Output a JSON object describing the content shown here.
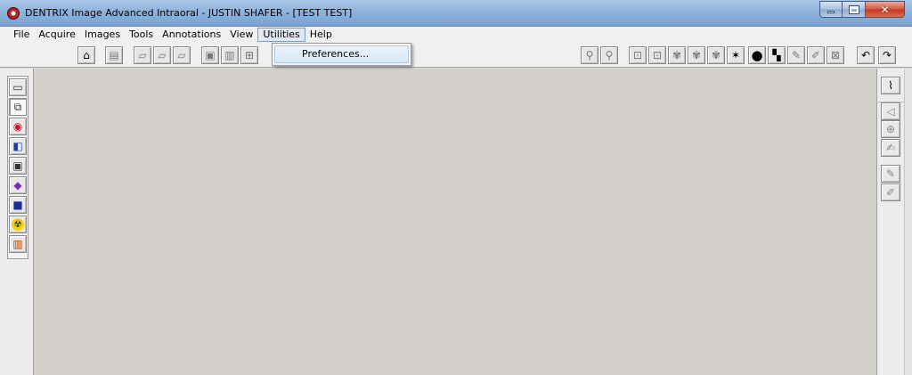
{
  "window": {
    "title": "DENTRIX Image Advanced Intraoral - JUSTIN SHAFER - [TEST TEST]",
    "buttons": {
      "minimize": "minimize-icon",
      "maximize": "maximize-icon",
      "close": "close-icon"
    },
    "close_glyph": "✕"
  },
  "menubar": {
    "items": [
      "File",
      "Acquire",
      "Images",
      "Tools",
      "Annotations",
      "View",
      "Utilities",
      "Help"
    ],
    "open_menu": "Utilities"
  },
  "utilities_menu": {
    "items": [
      "Preferences..."
    ]
  },
  "toolbar": {
    "buttons": [
      "tooth-capture-icon",
      "sensor-icon",
      "copy-icon",
      "paste-icon",
      "clipboard-icon",
      "save-icon",
      "print-icon",
      "layout-icon",
      "zoom-in-icon",
      "zoom-out-icon",
      "rotate-icon",
      "flip-icon",
      "tooth-icon",
      "tooth-compare-icon",
      "tooth-enhance-icon",
      "brightness-icon",
      "circle-icon",
      "contrast-icon",
      "pen-icon",
      "measure-icon",
      "grid-icon",
      "undo-icon",
      "redo-icon"
    ],
    "glyphs": {
      "tooth-capture": "🦷",
      "undo": "↶",
      "redo": "↷",
      "zoom": "🔍"
    }
  },
  "left_toolbar": {
    "buttons": [
      "image-view-icon",
      "bitewing-icon",
      "lips-icon",
      "camera-icon",
      "tv-icon",
      "book-icon",
      "monitor-icon",
      "radiation-icon",
      "chart-icon"
    ]
  },
  "right_toolbar": {
    "buttons": [
      "paperclip-icon",
      "audio-icon",
      "ruler-icon",
      "note-icon",
      "pen-icon",
      "pencil-icon"
    ]
  },
  "colors": {
    "title_bar": "#8fb3dc",
    "workspace": "#d4d0cc",
    "menu_highlight": "#dfe8f3"
  }
}
